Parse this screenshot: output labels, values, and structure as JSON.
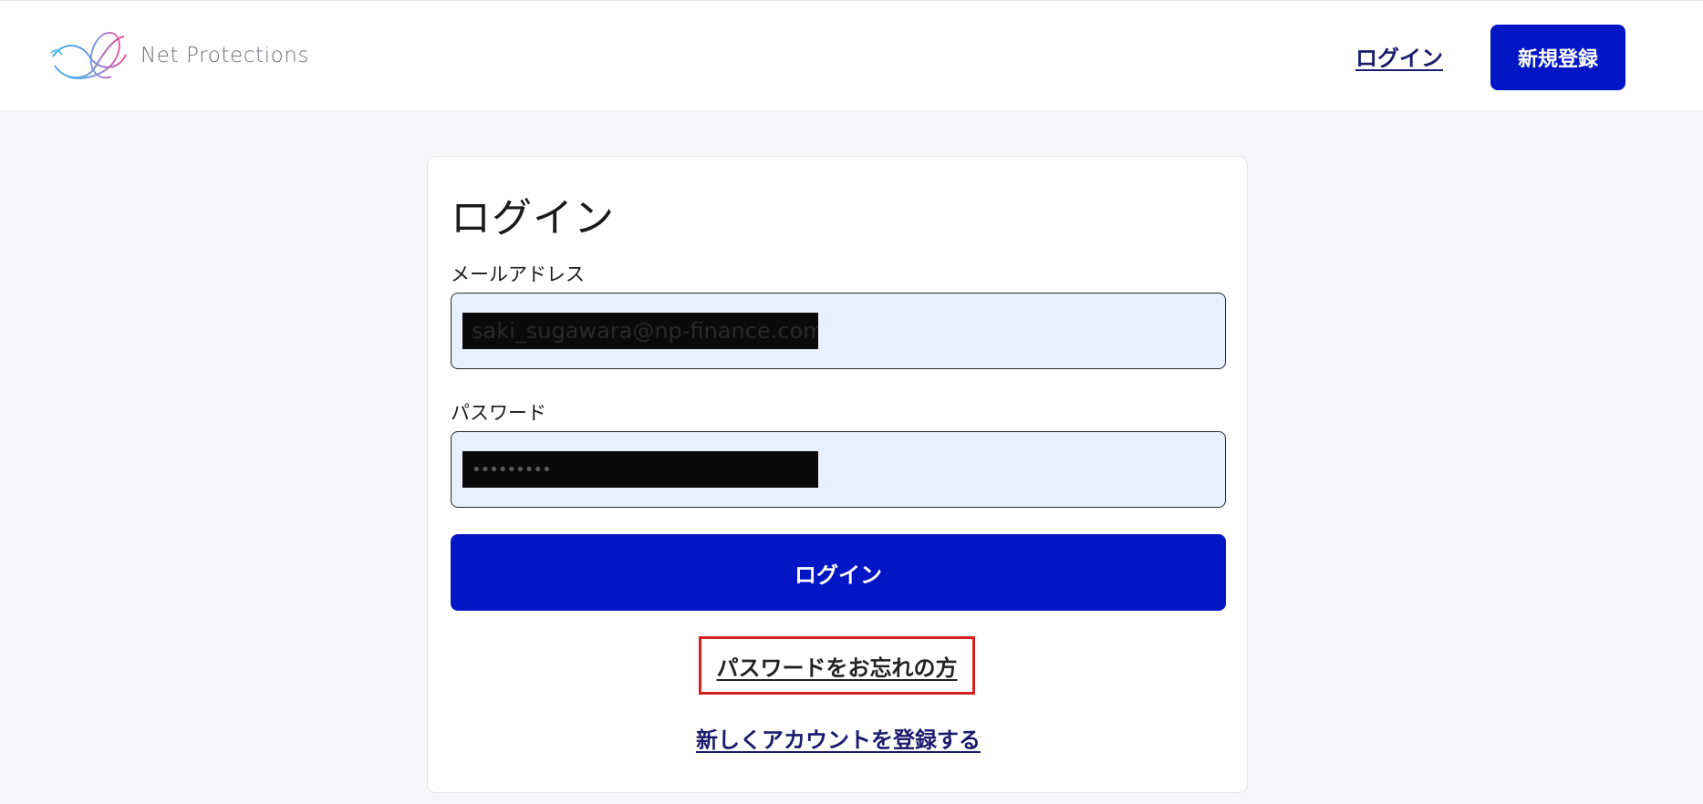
{
  "header": {
    "brand_name": "Net Protections",
    "login_link": "ログイン",
    "signup_button": "新規登録"
  },
  "login_form": {
    "title": "ログイン",
    "email": {
      "label": "メールアドレス",
      "value": "saki_sugawara@np-finance.com"
    },
    "password": {
      "label": "パスワード",
      "masked_value": "•••••••••"
    },
    "submit_button": "ログイン",
    "forgot_password_link": "パスワードをお忘れの方",
    "register_link": "新しくアカウントを登録する"
  },
  "colors": {
    "primary": "#0316c6",
    "page_background": "#f6f6f8",
    "input_background": "#e8effd",
    "link": "#1b1b6e",
    "highlight_border": "#d42020"
  },
  "icons": {
    "logo": "net-protections-logo-icon"
  }
}
